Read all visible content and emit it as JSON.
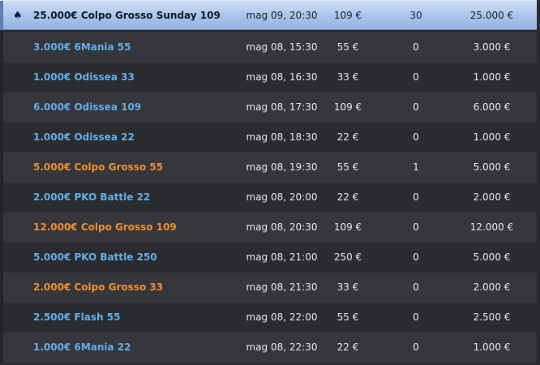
{
  "tournaments": [
    {
      "icon": "spade-icon",
      "name": "25.000€ Colpo Grosso Sunday 109",
      "date": "mag 09, 20:30",
      "buyin": "109 €",
      "players": "30",
      "prize": "25.000 €",
      "color": "highlight"
    },
    {
      "name": "3.000€ 6Mania 55",
      "date": "mag 08, 15:30",
      "buyin": "55 €",
      "players": "0",
      "prize": "3.000 €",
      "color": "blue"
    },
    {
      "name": "1.000€ Odissea 33",
      "date": "mag 08, 16:30",
      "buyin": "33 €",
      "players": "0",
      "prize": "1.000 €",
      "color": "blue"
    },
    {
      "name": "6.000€ Odissea 109",
      "date": "mag 08, 17:30",
      "buyin": "109 €",
      "players": "0",
      "prize": "6.000 €",
      "color": "blue"
    },
    {
      "name": "1.000€ Odissea 22",
      "date": "mag 08, 18:30",
      "buyin": "22 €",
      "players": "0",
      "prize": "1.000 €",
      "color": "blue"
    },
    {
      "name": "5.000€ Colpo Grosso 55",
      "date": "mag 08, 19:30",
      "buyin": "55 €",
      "players": "1",
      "prize": "5.000 €",
      "color": "orange"
    },
    {
      "name": "2.000€ PKO Battle 22",
      "date": "mag 08, 20:00",
      "buyin": "22 €",
      "players": "0",
      "prize": "2.000 €",
      "color": "blue"
    },
    {
      "name": "12.000€ Colpo Grosso 109",
      "date": "mag 08, 20:30",
      "buyin": "109 €",
      "players": "0",
      "prize": "12.000 €",
      "color": "orange"
    },
    {
      "name": "5.000€ PKO Battle 250",
      "date": "mag 08, 21:00",
      "buyin": "250 €",
      "players": "0",
      "prize": "5.000 €",
      "color": "blue"
    },
    {
      "name": "2.000€ Colpo Grosso 33",
      "date": "mag 08, 21:30",
      "buyin": "33 €",
      "players": "0",
      "prize": "2.000 €",
      "color": "orange"
    },
    {
      "name": "2.500€ Flash 55",
      "date": "mag 08, 22:00",
      "buyin": "55 €",
      "players": "0",
      "prize": "2.500 €",
      "color": "blue"
    },
    {
      "name": "1.000€ 6Mania 22",
      "date": "mag 08, 22:30",
      "buyin": "22 €",
      "players": "0",
      "prize": "1.000 €",
      "color": "blue"
    }
  ],
  "colors": {
    "blue": "#63aee8",
    "orange": "#f0902a",
    "highlight": "#a9c4ea"
  }
}
